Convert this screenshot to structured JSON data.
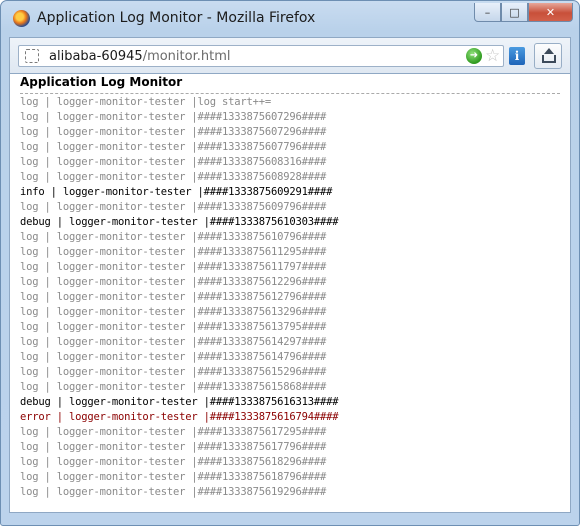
{
  "window": {
    "title": "Application Log Monitor - Mozilla Firefox",
    "min_label": "–",
    "max_label": "□",
    "close_label": "✕"
  },
  "address_bar": {
    "host": "alibaba-60945",
    "path": "/monitor.html"
  },
  "icons": {
    "site": "site-identity-icon",
    "go": "go-arrow-icon",
    "bookmark": "star-icon",
    "info": "info-icon",
    "share": "share-icon"
  },
  "colors": {
    "log": "#8a8a8a",
    "info": "#000000",
    "debug": "#000000",
    "error": "#8b0000"
  },
  "page": {
    "title": "Application Log Monitor"
  },
  "logs": [
    {
      "level": "log",
      "text": "log | logger-monitor-tester |log start++="
    },
    {
      "level": "log",
      "text": "log | logger-monitor-tester |####1333875607296####"
    },
    {
      "level": "log",
      "text": "log | logger-monitor-tester |####1333875607296####"
    },
    {
      "level": "log",
      "text": "log | logger-monitor-tester |####1333875607796####"
    },
    {
      "level": "log",
      "text": "log | logger-monitor-tester |####1333875608316####"
    },
    {
      "level": "log",
      "text": "log | logger-monitor-tester |####1333875608928####"
    },
    {
      "level": "info",
      "text": "info | logger-monitor-tester |####1333875609291####"
    },
    {
      "level": "log",
      "text": "log | logger-monitor-tester |####1333875609796####"
    },
    {
      "level": "debug",
      "text": "debug | logger-monitor-tester |####1333875610303####"
    },
    {
      "level": "log",
      "text": "log | logger-monitor-tester |####1333875610796####"
    },
    {
      "level": "log",
      "text": "log | logger-monitor-tester |####1333875611295####"
    },
    {
      "level": "log",
      "text": "log | logger-monitor-tester |####1333875611797####"
    },
    {
      "level": "log",
      "text": "log | logger-monitor-tester |####1333875612296####"
    },
    {
      "level": "log",
      "text": "log | logger-monitor-tester |####1333875612796####"
    },
    {
      "level": "log",
      "text": "log | logger-monitor-tester |####1333875613296####"
    },
    {
      "level": "log",
      "text": "log | logger-monitor-tester |####1333875613795####"
    },
    {
      "level": "log",
      "text": "log | logger-monitor-tester |####1333875614297####"
    },
    {
      "level": "log",
      "text": "log | logger-monitor-tester |####1333875614796####"
    },
    {
      "level": "log",
      "text": "log | logger-monitor-tester |####1333875615296####"
    },
    {
      "level": "log",
      "text": "log | logger-monitor-tester |####1333875615868####"
    },
    {
      "level": "debug",
      "text": "debug | logger-monitor-tester |####1333875616313####"
    },
    {
      "level": "error",
      "text": "error | logger-monitor-tester |####1333875616794####"
    },
    {
      "level": "log",
      "text": "log | logger-monitor-tester |####1333875617295####"
    },
    {
      "level": "log",
      "text": "log | logger-monitor-tester |####1333875617796####"
    },
    {
      "level": "log",
      "text": "log | logger-monitor-tester |####1333875618296####"
    },
    {
      "level": "log",
      "text": "log | logger-monitor-tester |####1333875618796####"
    },
    {
      "level": "log",
      "text": "log | logger-monitor-tester |####1333875619296####"
    }
  ]
}
